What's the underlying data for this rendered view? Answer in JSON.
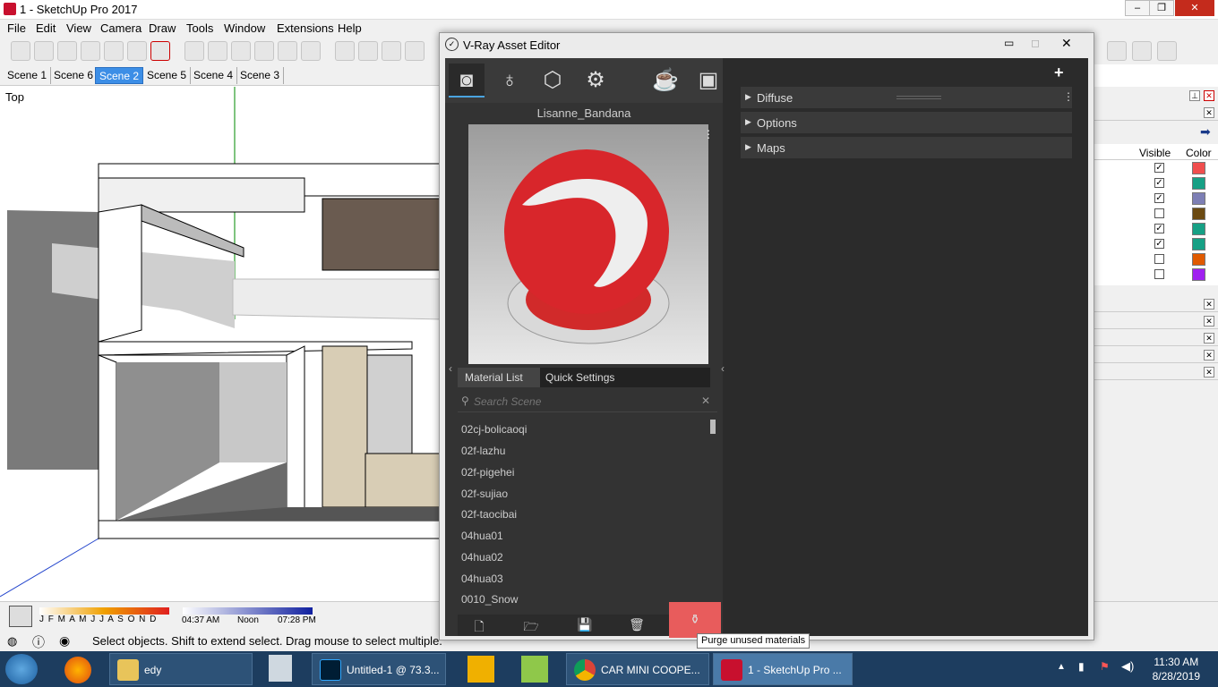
{
  "app": {
    "title": "1 - SketchUp Pro 2017",
    "menus": [
      "File",
      "Edit",
      "View",
      "Camera",
      "Draw",
      "Tools",
      "Window",
      "Extensions",
      "Help"
    ],
    "scenes": [
      "Scene 1",
      "Scene 6",
      "Scene 2",
      "Scene 5",
      "Scene 4",
      "Scene 3"
    ],
    "active_scene": "Scene 2",
    "view_label": "Top"
  },
  "shadow": {
    "months": "J F M A M J J A S O N D",
    "time_start": "04:37 AM",
    "time_mid": "Noon",
    "time_end": "07:28 PM"
  },
  "status": {
    "text": "Select objects. Shift to extend select. Drag mouse to select multiple."
  },
  "vray": {
    "title": "V-Ray Asset Editor",
    "material_name": "Lisanne_Bandana",
    "tab_material_list": "Material List",
    "tab_quick_settings": "Quick Settings",
    "search_placeholder": "Search Scene",
    "materials": [
      "02cj-bolicaoqi",
      "02f-lazhu",
      "02f-pigehei",
      "02f-sujiao",
      "02f-taocibai",
      "04hua01",
      "04hua02",
      "04hua03",
      "0010_Snow"
    ],
    "rollouts": [
      "Diffuse",
      "Options",
      "Maps"
    ],
    "tooltip": "Purge unused materials",
    "add_symbol": "+"
  },
  "layers": {
    "col_visible": "Visible",
    "col_color": "Color",
    "rows": [
      {
        "visible": true,
        "color": "#f04e4e"
      },
      {
        "visible": true,
        "color": "#16a085"
      },
      {
        "visible": true,
        "color": "#7d7fb5"
      },
      {
        "visible": false,
        "color": "#6b4a12"
      },
      {
        "visible": true,
        "color": "#16a085"
      },
      {
        "visible": true,
        "color": "#16a085"
      },
      {
        "visible": false,
        "color": "#e05a00"
      },
      {
        "visible": false,
        "color": "#a020f0"
      }
    ]
  },
  "taskbar": {
    "items": [
      "edy",
      "Untitled-1 @ 73.3...",
      "CAR MINI COOPE...",
      "1 - SketchUp Pro ..."
    ],
    "time": "11:30 AM",
    "date": "8/28/2019"
  }
}
